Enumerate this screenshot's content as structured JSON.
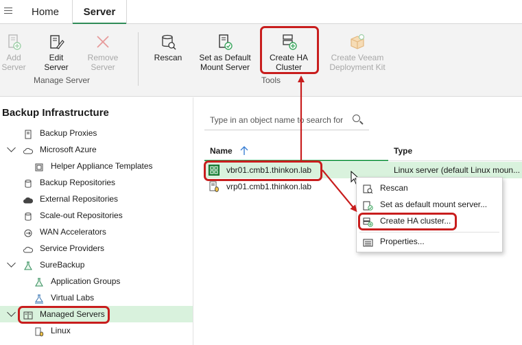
{
  "tabs": {
    "home": "Home",
    "server": "Server"
  },
  "ribbon": {
    "add_server": "Add\nServer",
    "edit_server": "Edit\nServer",
    "remove_server": "Remove\nServer",
    "rescan": "Rescan",
    "set_default_mount": "Set as Default\nMount Server",
    "create_ha_cluster": "Create HA\nCluster",
    "create_veeam_kit": "Create Veeam\nDeployment Kit",
    "group_manage": "Manage Server",
    "group_tools": "Tools"
  },
  "tree": {
    "title": "Backup Infrastructure",
    "items": [
      {
        "label": "Backup Proxies",
        "icon": "server-icon"
      },
      {
        "label": "Microsoft Azure",
        "icon": "cloud-icon"
      },
      {
        "label": "Helper Appliance Templates",
        "icon": "template-icon"
      },
      {
        "label": "Backup Repositories",
        "icon": "database-icon"
      },
      {
        "label": "External Repositories",
        "icon": "cloud-storage-icon"
      },
      {
        "label": "Scale-out Repositories",
        "icon": "scaleout-icon"
      },
      {
        "label": "WAN Accelerators",
        "icon": "wan-icon"
      },
      {
        "label": "Service Providers",
        "icon": "provider-cloud-icon"
      },
      {
        "label": "SureBackup",
        "icon": "flask-icon"
      },
      {
        "label": "Application Groups",
        "icon": "flask-icon"
      },
      {
        "label": "Virtual Labs",
        "icon": "lab-icon"
      },
      {
        "label": "Managed Servers",
        "icon": "managed-servers-icon"
      },
      {
        "label": "Linux",
        "icon": "linux-icon"
      }
    ]
  },
  "search": {
    "placeholder": "Type in an object name to search for"
  },
  "table": {
    "columns": [
      "Name",
      "Type"
    ],
    "rows": [
      {
        "name": "vbr01.cmb1.thinkon.lab",
        "type": "Linux server (default Linux moun..."
      },
      {
        "name": "vrp01.cmb1.thinkon.lab",
        "type": ""
      }
    ]
  },
  "context_menu": {
    "items": [
      "Rescan",
      "Set as default mount server...",
      "Create HA cluster...",
      "Properties..."
    ]
  },
  "colors": {
    "accent_green": "#3aa55d",
    "highlight_red": "#c81d1d",
    "selection": "#d9f2dd"
  }
}
